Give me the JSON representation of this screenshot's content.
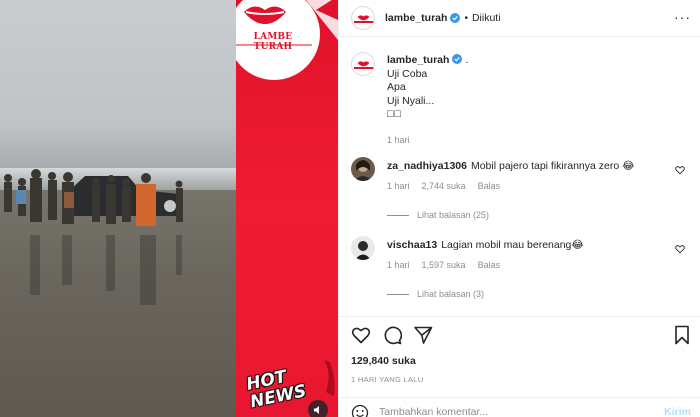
{
  "post": {
    "username": "lambe_turah",
    "separator": "•",
    "follow_status": "Diikuti",
    "caption_lines": [
      "Uji Coba",
      "Apa",
      "Uji Nyali...",
      "□□"
    ],
    "caption_suffix": ".",
    "time_ago": "1 hari",
    "likes": "129,840 suka",
    "date_label": "1 HARI YANG LALU"
  },
  "media": {
    "brand_text": "LAMBE TURAH",
    "hot_news_line1": "HOT",
    "hot_news_line2": "NEWS"
  },
  "comments": [
    {
      "username": "za_nadhiya1306",
      "text": "Mobil pajero tapi fikirannya zero 😂",
      "time": "1 hari",
      "likes": "2,744 suka",
      "reply_label": "Balas",
      "view_replies": "Lihat balasan (25)"
    },
    {
      "username": "vischaa13",
      "text": "Lagian mobil mau berenang😂",
      "time": "1 hari",
      "likes": "1,597 suka",
      "reply_label": "Balas",
      "view_replies": "Lihat balasan (3)"
    }
  ],
  "composer": {
    "placeholder": "Tambahkan komentar...",
    "post_label": "Kirim"
  },
  "colors": {
    "brand_red": "#e0112b",
    "verified_blue": "#3897f0",
    "muted": "#8e8e8e"
  },
  "icons": [
    "more-icon",
    "verified-badge-icon",
    "heart-icon",
    "comment-icon",
    "share-icon",
    "bookmark-icon",
    "emoji-icon",
    "sound-icon"
  ]
}
